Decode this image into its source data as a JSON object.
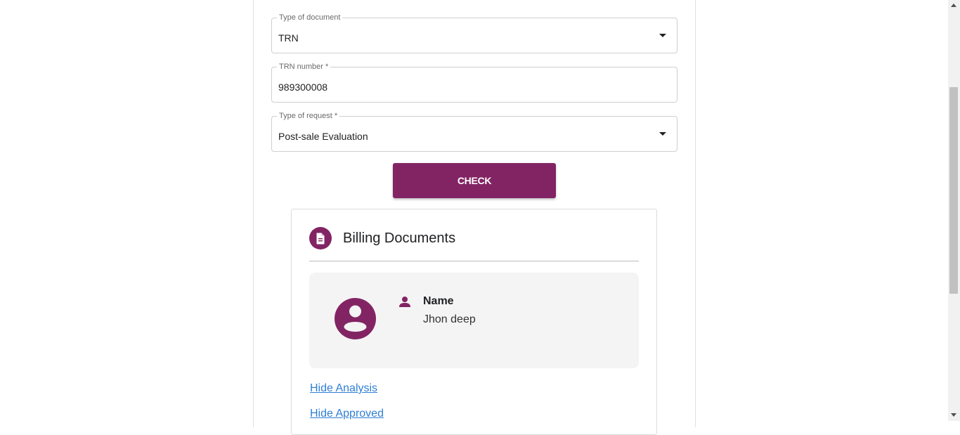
{
  "form": {
    "document_type": {
      "label": "Type of document",
      "value": "TRN"
    },
    "trn_number": {
      "label": "TRN number *",
      "value": "989300008"
    },
    "request_type": {
      "label": "Type of request *",
      "value": "Post-sale Evaluation"
    },
    "check_label": "CHECK"
  },
  "card": {
    "title": "Billing Documents",
    "icon": "document-icon",
    "profile": {
      "name_label": "Name",
      "name_value": "Jhon deep"
    },
    "links": {
      "hide_analysis": "Hide Analysis",
      "hide_approved": "Hide Approved"
    }
  },
  "colors": {
    "accent": "#822464",
    "link": "#2f7fd4",
    "profile_bg": "#f4f4f4"
  }
}
